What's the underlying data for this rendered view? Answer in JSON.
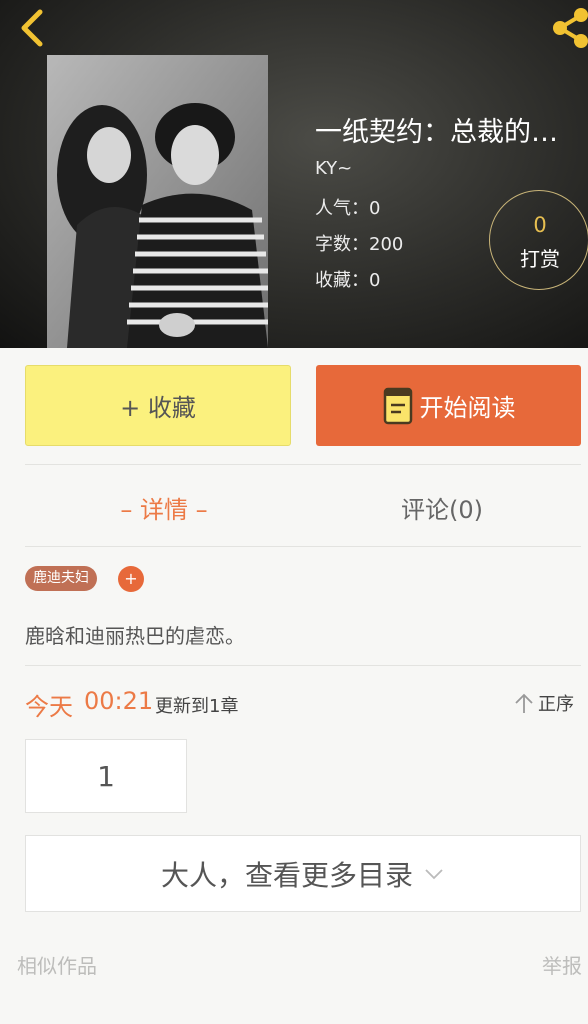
{
  "header": {
    "back_icon": "chevron-left-icon",
    "share_icon": "share-icon",
    "accent_color": "#f1c232"
  },
  "book": {
    "title": "一纸契约：总裁的…",
    "author": "KY~",
    "popularity": "人气：0",
    "word_count": "字数：200",
    "favorites": "收藏：0"
  },
  "tip": {
    "count": "0",
    "label": "打赏"
  },
  "actions": {
    "favorite_label": "+ 收藏",
    "read_label": "开始阅读",
    "read_icon": "book-icon"
  },
  "tabs": {
    "detail": "– 详情 –",
    "comments": "评论(0)"
  },
  "tags": {
    "items": [
      "鹿迪夫妇"
    ],
    "add": "+"
  },
  "description": "鹿晗和迪丽热巴的虐恋。",
  "update": {
    "day": "今天",
    "time": "00:21",
    "note": "更新到1章",
    "order_label": "正序"
  },
  "chapters": [
    "1"
  ],
  "more_catalog": "大人，查看更多目录",
  "footer": {
    "similar": "相似作品",
    "report": "举报"
  },
  "colors": {
    "orange": "#e7693a",
    "yellow": "#fbf17e",
    "tag": "#c07055"
  }
}
